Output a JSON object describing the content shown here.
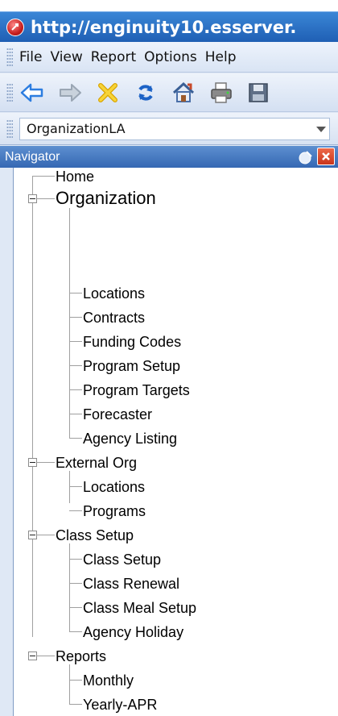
{
  "window": {
    "title": "http://enginuity10.esserver."
  },
  "menubar": {
    "items": [
      "File",
      "View",
      "Report",
      "Options",
      "Help"
    ]
  },
  "toolbar": {
    "buttons": [
      {
        "name": "back-arrow-icon",
        "color": "#2c7de0"
      },
      {
        "name": "forward-arrow-icon",
        "color": "#9aa6b4"
      },
      {
        "name": "delete-x-icon",
        "color": "#f0c419"
      },
      {
        "name": "refresh-icon",
        "color": "#1c62c6"
      },
      {
        "name": "home-icon",
        "color": "#4a6fa8"
      },
      {
        "name": "print-icon",
        "color": "#606060"
      },
      {
        "name": "save-icon",
        "color": "#5f6f86"
      }
    ]
  },
  "organization_select": {
    "value": "OrganizationLA"
  },
  "navigator": {
    "title": "Navigator",
    "tree": [
      {
        "label": "Home",
        "level": 0
      },
      {
        "label": "Organization",
        "level": 0,
        "expanded": true,
        "children": [
          "Locations",
          "Contracts",
          "Funding Codes",
          "Program Setup",
          "Program Targets",
          "Forecaster",
          "Agency Listing"
        ]
      },
      {
        "label": "External Org",
        "level": 0,
        "expanded": true,
        "children": [
          "Locations",
          "Programs"
        ]
      },
      {
        "label": "Class Setup",
        "level": 0,
        "expanded": true,
        "children": [
          "Class Setup",
          "Class Renewal",
          "Class Meal Setup",
          "Agency Holiday"
        ]
      },
      {
        "label": "Reports",
        "level": 0,
        "expanded": true,
        "children": [
          "Monthly",
          "Yearly-APR"
        ]
      }
    ]
  },
  "colors": {
    "titlebar": "#1f5fb4",
    "nav_header": "#3568b3",
    "chrome": "#dfe8f5"
  }
}
